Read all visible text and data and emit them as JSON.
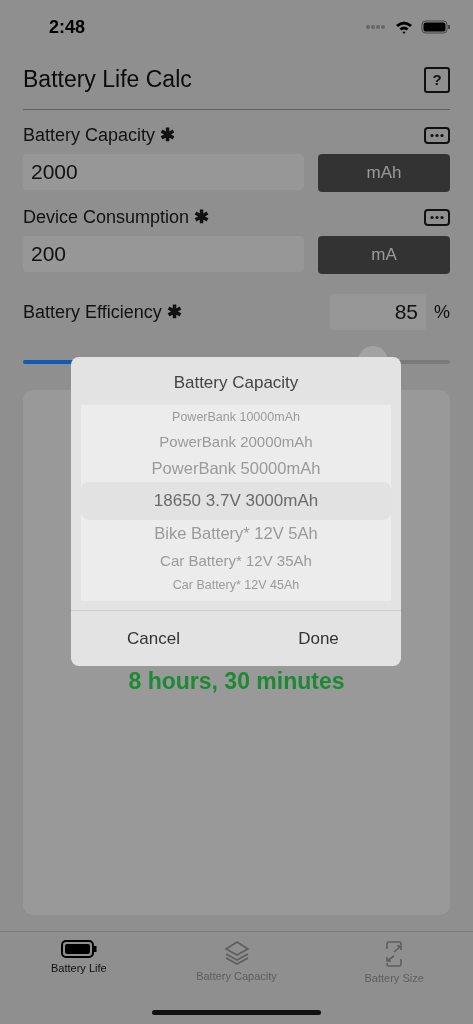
{
  "status_bar": {
    "time": "2:48"
  },
  "header": {
    "title": "Battery Life Calc",
    "help_icon": "?"
  },
  "fields": [
    {
      "label": "Battery Capacity",
      "required_mark": "✱",
      "value": "2000",
      "unit": "mAh"
    },
    {
      "label": "Device Consumption",
      "required_mark": "✱",
      "value": "200",
      "unit": "mA"
    }
  ],
  "efficiency": {
    "label": "Battery Efficiency",
    "required_mark": "✱",
    "value": "85",
    "unit": "%",
    "level": 0.82
  },
  "result": {
    "text": "8 hours, 30 minutes"
  },
  "dialog": {
    "title": "Battery Capacity",
    "options": [
      {
        "label": "PowerBank 10000mAh",
        "selected": false
      },
      {
        "label": "PowerBank 20000mAh",
        "selected": false
      },
      {
        "label": "PowerBank 50000mAh",
        "selected": false
      },
      {
        "label": "18650 3.7V 3000mAh",
        "selected": true
      },
      {
        "label": "Bike Battery* 12V 5Ah",
        "selected": false
      },
      {
        "label": "Car Battery* 12V 35Ah",
        "selected": false
      },
      {
        "label": "Car Battery* 12V 45Ah",
        "selected": false
      }
    ],
    "buttons": [
      "Cancel",
      "Done"
    ]
  },
  "tabs": [
    {
      "label": "Battery Life",
      "kind": "battery",
      "selected": true
    },
    {
      "label": "Battery Capacity",
      "kind": "layers",
      "selected": false
    },
    {
      "label": "Battery Size",
      "kind": "resize",
      "selected": false
    }
  ]
}
